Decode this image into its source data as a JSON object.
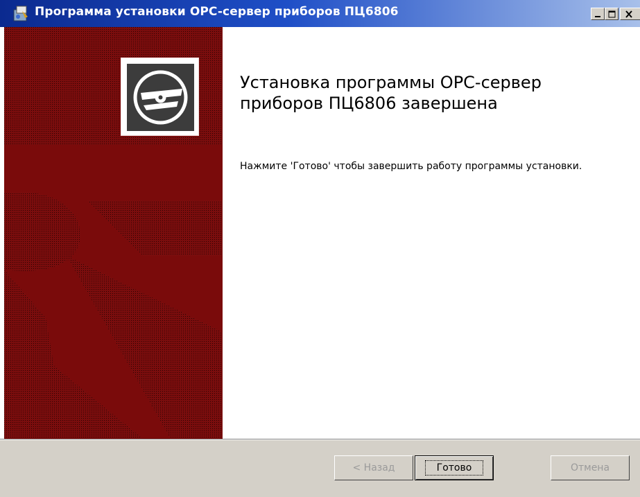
{
  "window": {
    "title": "Программа установки OPC-сервер приборов ПЦ6806",
    "app_icon": "installer-icon",
    "controls": [
      "minimize-icon",
      "maximize-icon",
      "close-icon"
    ]
  },
  "main": {
    "heading": "Установка программы OPC-сервер приборов ПЦ6806 завершена",
    "message": "Нажмите 'Готово' чтобы завершить работу программы установки.",
    "banner_icon": "cd-disc-icon"
  },
  "footer": {
    "back_label": "< Назад",
    "finish_label": "Готово",
    "cancel_label": "Отмена"
  },
  "colors": {
    "banner": "#6f0b0b",
    "title_start": "#0b2a8f",
    "title_end": "#a8c0ea",
    "dialog": "#d4d0c8"
  }
}
